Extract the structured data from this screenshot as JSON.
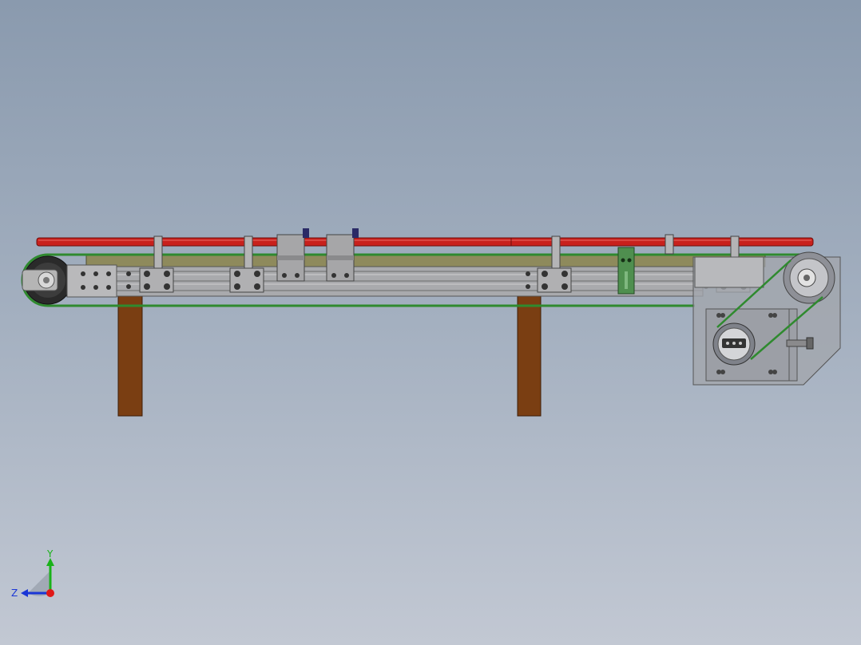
{
  "colors": {
    "background_top": "#8a9aae",
    "background_bottom": "#c2c8d3",
    "guide_rail": "#c8201c",
    "belt": "#2f8a2f",
    "leg": "#7a3e12",
    "frame": "#a9aaad",
    "bed": "#8e8a5c",
    "motor_plate": "#9c9fa6",
    "mount_block": "#4f8f4f"
  },
  "triad": {
    "y_label": "Y",
    "z_label": "Z",
    "y_color": "#19b219",
    "z_color": "#1a36d6",
    "origin_color": "#e01818"
  },
  "icons": {
    "triad": "coordinate-triad-icon",
    "pulley": "pulley-icon"
  }
}
